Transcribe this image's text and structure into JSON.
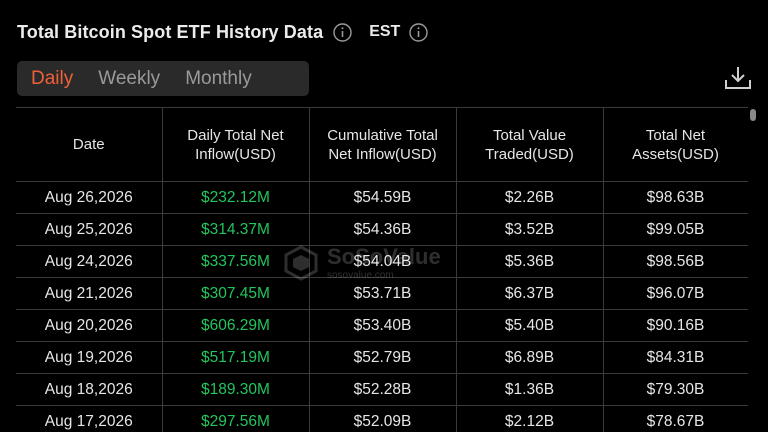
{
  "header": {
    "title": "Total Bitcoin Spot ETF History Data",
    "timezone": "EST"
  },
  "tabs": [
    {
      "label": "Daily",
      "active": true
    },
    {
      "label": "Weekly",
      "active": false
    },
    {
      "label": "Monthly",
      "active": false
    }
  ],
  "table": {
    "columns": [
      "Date",
      "Daily Total Net Inflow(USD)",
      "Cumulative Total Net Inflow(USD)",
      "Total Value Traded(USD)",
      "Total Net Assets(USD)"
    ],
    "rows": [
      [
        "Aug 26,2026",
        "$232.12M",
        "$54.59B",
        "$2.26B",
        "$98.63B"
      ],
      [
        "Aug 25,2026",
        "$314.37M",
        "$54.36B",
        "$3.52B",
        "$99.05B"
      ],
      [
        "Aug 24,2026",
        "$337.56M",
        "$54.04B",
        "$5.36B",
        "$98.56B"
      ],
      [
        "Aug 21,2026",
        "$307.45M",
        "$53.71B",
        "$6.37B",
        "$96.07B"
      ],
      [
        "Aug 20,2026",
        "$606.29M",
        "$53.40B",
        "$5.40B",
        "$90.16B"
      ],
      [
        "Aug 19,2026",
        "$517.19M",
        "$52.79B",
        "$6.89B",
        "$84.31B"
      ],
      [
        "Aug 18,2026",
        "$189.30M",
        "$52.28B",
        "$1.36B",
        "$79.30B"
      ],
      [
        "Aug 17,2026",
        "$297.56M",
        "$52.09B",
        "$2.12B",
        "$78.67B"
      ]
    ]
  },
  "watermark": {
    "main": "SoSoValue",
    "sub": "sosovalue.com"
  },
  "colors": {
    "accent": "#f0603a",
    "positive": "#22c55e",
    "background": "#000000"
  },
  "icons": {
    "info": "info-circle-icon",
    "download": "download-icon"
  }
}
